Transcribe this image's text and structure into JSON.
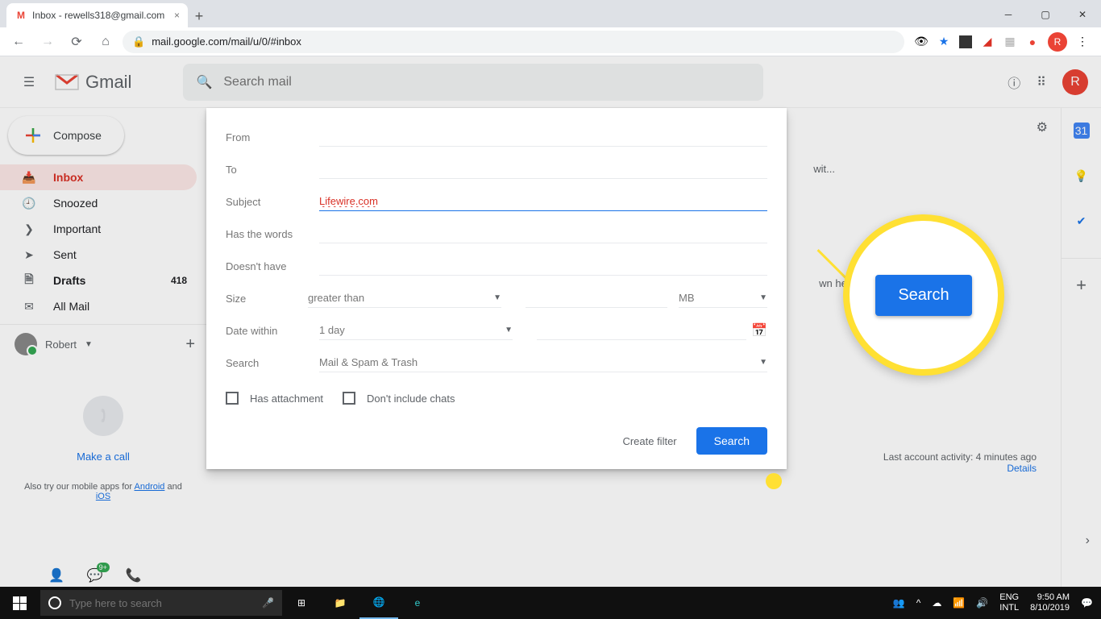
{
  "browser": {
    "tab_title": "Inbox - rewells318@gmail.com",
    "url": "mail.google.com/mail/u/0/#inbox",
    "new_tab": "+"
  },
  "gmail": {
    "brand": "Gmail",
    "search_placeholder": "Search mail",
    "compose": "Compose",
    "sidebar": [
      {
        "label": "Inbox",
        "icon": "📥"
      },
      {
        "label": "Snoozed",
        "icon": "🕘"
      },
      {
        "label": "Important",
        "icon": "❯"
      },
      {
        "label": "Sent",
        "icon": "➤"
      },
      {
        "label": "Drafts",
        "icon": "🗎",
        "count": "418"
      },
      {
        "label": "All Mail",
        "icon": "✉"
      }
    ],
    "labels": {
      "user": "Robert"
    },
    "hangouts": {
      "make_call": "Make a call"
    },
    "mobile_apps": {
      "prefix": "Also try our mobile apps for ",
      "android": "Android",
      "and": " and ",
      "ios": "iOS"
    },
    "avatar_letter": "R"
  },
  "adv": {
    "from": "From",
    "to": "To",
    "subject": "Subject",
    "subject_value": "Lifewire.com",
    "has_words": "Has the words",
    "doesnt_have": "Doesn't have",
    "size": "Size",
    "size_op": "greater than",
    "size_unit": "MB",
    "date_within": "Date within",
    "date_val": "1 day",
    "search": "Search",
    "search_in": "Mail & Spam & Trash",
    "has_attach": "Has attachment",
    "no_chats": "Don't include chats",
    "create_filter": "Create filter",
    "search_btn": "Search"
  },
  "callout_search": "Search",
  "bg": {
    "promo": "wit...",
    "dnd": "wn here."
  },
  "footer": {
    "activity": "Last account activity: 4 minutes ago",
    "details": "Details"
  },
  "taskbar": {
    "search_placeholder": "Type here to search",
    "lang": "ENG",
    "kb": "INTL",
    "time": "9:50 AM",
    "date": "8/10/2019"
  }
}
